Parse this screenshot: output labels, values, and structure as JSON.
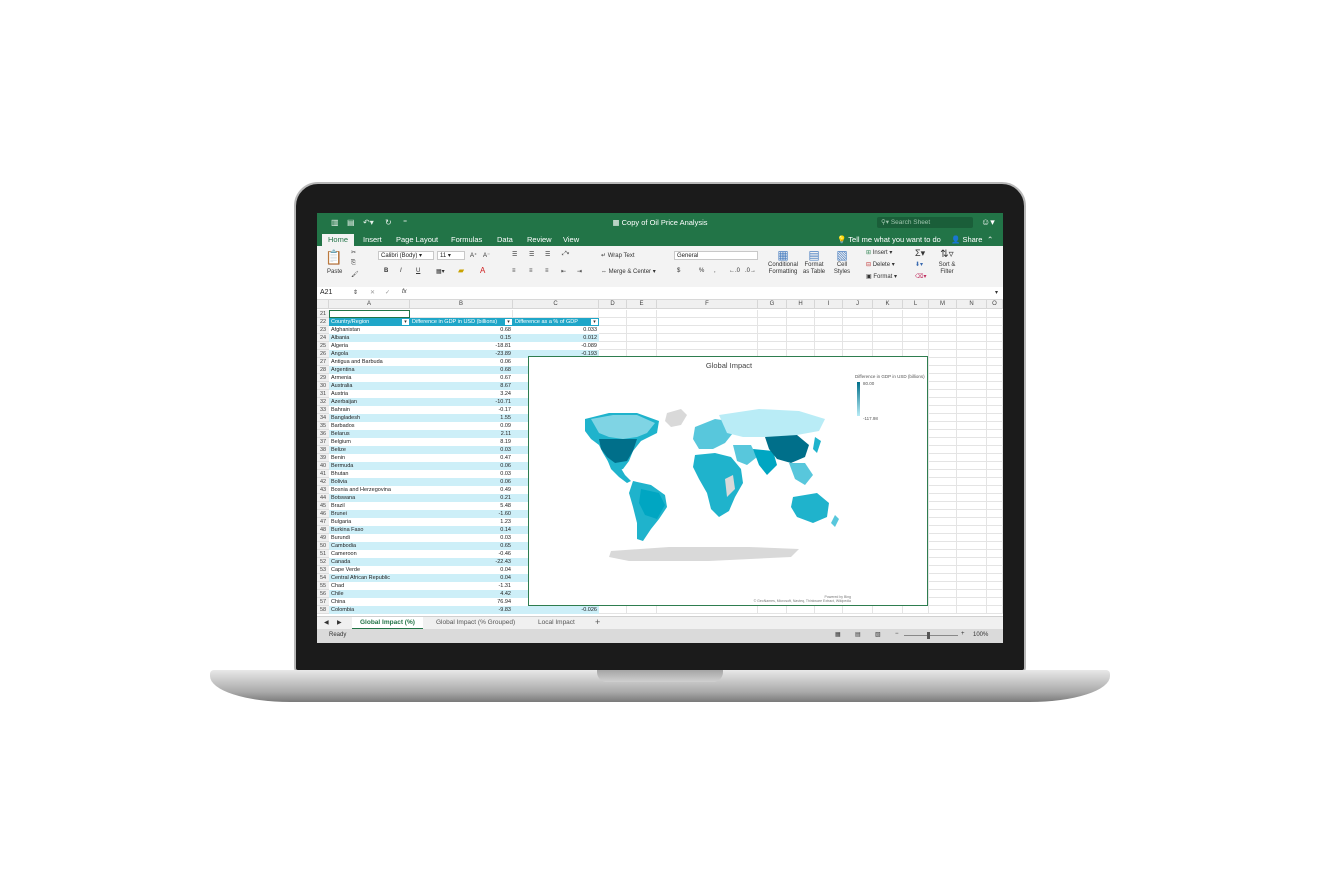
{
  "window": {
    "title": "Copy of Oil Price Analysis"
  },
  "search": {
    "placeholder": "Search Sheet"
  },
  "tabs": [
    "Home",
    "Insert",
    "Page Layout",
    "Formulas",
    "Data",
    "Review",
    "View"
  ],
  "tell_me": "Tell me what you want to do",
  "share": "Share",
  "ribbon": {
    "paste": "Paste",
    "font_name": "Calibri (Body)",
    "font_size": "11",
    "bold": "B",
    "italic": "I",
    "underline": "U",
    "wrap_text": "Wrap Text",
    "merge_center": "Merge & Center",
    "number_format": "General",
    "currency": "$",
    "percent": "%",
    "comma": ",",
    "conditional_formatting": [
      "Conditional",
      "Formatting"
    ],
    "format_as_table": [
      "Format",
      "as Table"
    ],
    "cell_styles": [
      "Cell",
      "Styles"
    ],
    "insert": "Insert",
    "delete": "Delete",
    "format": "Format",
    "sort_filter": [
      "Sort &",
      "Filter"
    ]
  },
  "formula_bar": {
    "name_box": "A21",
    "fx": "fx",
    "cancel": "✕",
    "enter": "✓",
    "formula": ""
  },
  "columns": [
    "A",
    "B",
    "C",
    "D",
    "E",
    "F",
    "G",
    "H",
    "I",
    "J",
    "K",
    "L",
    "M",
    "N",
    "O"
  ],
  "table": {
    "headers": [
      "Country/Region",
      "Difference in GDP in USD (billions)",
      "Difference as a % of GDP"
    ],
    "first_row_number": 21,
    "rows": [
      [
        "Afghanistan",
        "0.68",
        "0.033"
      ],
      [
        "Albania",
        "0.15",
        "0.012"
      ],
      [
        "Algeria",
        "-18.81",
        "-0.089"
      ],
      [
        "Angola",
        "-23.89",
        "-0.193"
      ],
      [
        "Antigua and Barbuda",
        "0.06",
        ""
      ],
      [
        "Argentina",
        "0.68",
        ""
      ],
      [
        "Armenia",
        "0.67",
        ""
      ],
      [
        "Australia",
        "8.67",
        ""
      ],
      [
        "Austria",
        "3.24",
        ""
      ],
      [
        "Azerbaijan",
        "-10.71",
        ""
      ],
      [
        "Bahrain",
        "-0.17",
        ""
      ],
      [
        "Bangladesh",
        "1.55",
        ""
      ],
      [
        "Barbados",
        "0.09",
        ""
      ],
      [
        "Belarus",
        "2.11",
        ""
      ],
      [
        "Belgium",
        "8.19",
        ""
      ],
      [
        "Belize",
        "0.03",
        ""
      ],
      [
        "Benin",
        "0.47",
        ""
      ],
      [
        "Bermuda",
        "0.06",
        ""
      ],
      [
        "Bhutan",
        "0.03",
        ""
      ],
      [
        "Bolivia",
        "0.06",
        ""
      ],
      [
        "Bosnia and Herzegovina",
        "0.49",
        ""
      ],
      [
        "Botswana",
        "0.21",
        ""
      ],
      [
        "Brazil",
        "5.48",
        ""
      ],
      [
        "Brunei",
        "-1.60",
        ""
      ],
      [
        "Bulgaria",
        "1.23",
        ""
      ],
      [
        "Burkina Faso",
        "0.14",
        ""
      ],
      [
        "Burundi",
        "0.03",
        ""
      ],
      [
        "Cambodia",
        "0.65",
        ""
      ],
      [
        "Cameroon",
        "-0.46",
        ""
      ],
      [
        "Canada",
        "-22.43",
        ""
      ],
      [
        "Cape Verde",
        "0.04",
        ""
      ],
      [
        "Central African Republic",
        "0.04",
        ""
      ],
      [
        "Chad",
        "-1.31",
        ""
      ],
      [
        "Chile",
        "4.42",
        ""
      ],
      [
        "China",
        "76.94",
        ""
      ],
      [
        "Colombia",
        "-9.83",
        "-0.026"
      ]
    ]
  },
  "chart": {
    "title": "Global Impact",
    "legend_title": "Difference in GDP in USD (billions)",
    "legend_max": "80.00",
    "legend_min": "-117.98",
    "credit_line1": "Powered by Bing",
    "credit_line2": "© GeoNames, Microsoft, Navteq, Thinkware Extract, Wikipedia",
    "colors": {
      "high": "#006f8a",
      "mid": "#1fb3cc",
      "low": "#b9ecf6",
      "nodata": "#d9d9d9"
    }
  },
  "sheets": [
    "Global Impact (%)",
    "Global Impact (% Grouped)",
    "Local Impact"
  ],
  "status": {
    "ready": "Ready",
    "zoom": "100%",
    "zoom_minus": "−",
    "zoom_plus": "+"
  },
  "accent": "#227447"
}
